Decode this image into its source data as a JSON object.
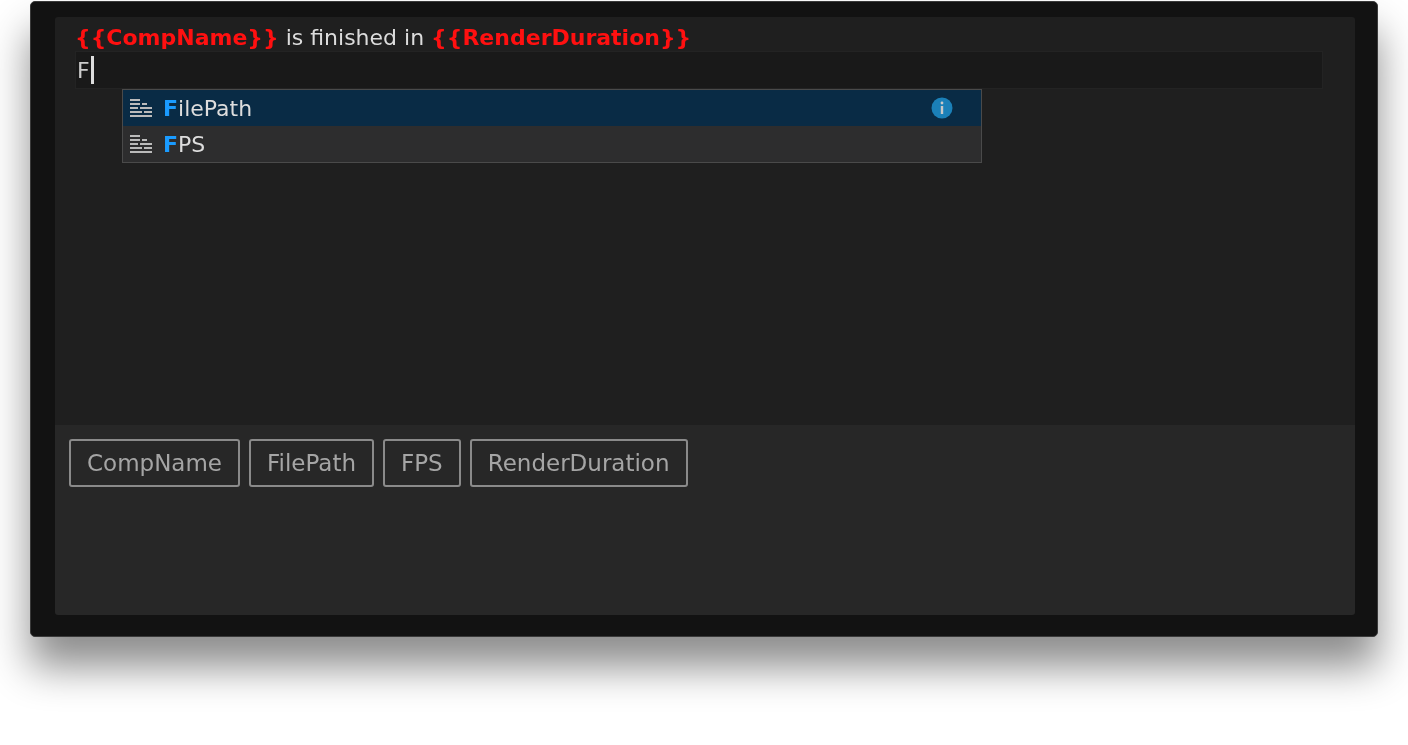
{
  "editor": {
    "template_line": "**{{CompName}}** is finished in **{{RenderDuration}}**",
    "input_value": "F",
    "suggestions": [
      {
        "match": "F",
        "rest": "ilePath",
        "selected": true
      },
      {
        "match": "F",
        "rest": "PS",
        "selected": false
      }
    ]
  },
  "variables": [
    "CompName",
    "FilePath",
    "FPS",
    "RenderDuration"
  ]
}
